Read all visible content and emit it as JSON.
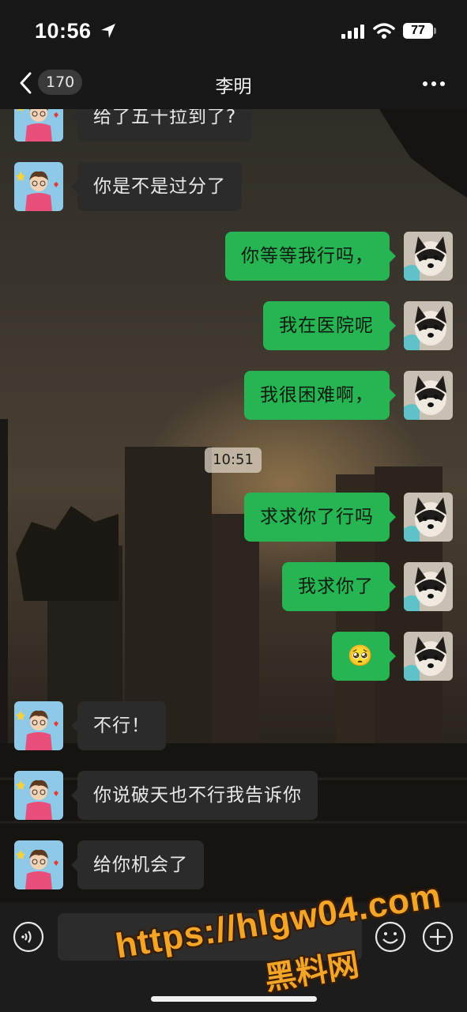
{
  "status_bar": {
    "time": "10:56",
    "battery": "77",
    "icons": [
      "location-arrow-icon",
      "signal-icon",
      "wifi-icon",
      "battery-icon"
    ]
  },
  "nav": {
    "back_icon": "chevron-left-icon",
    "unread_count": "170",
    "title": "李明",
    "more_icon": "more-dots-icon"
  },
  "messages": [
    {
      "side": "in",
      "text": "给了五十拉到了?"
    },
    {
      "side": "in",
      "text": "你是不是过分了"
    },
    {
      "side": "out",
      "text": "你等等我行吗，"
    },
    {
      "side": "out",
      "text": "我在医院呢"
    },
    {
      "side": "out",
      "text": "我很困难啊，"
    },
    {
      "side": "out",
      "text": "求求你了行吗"
    },
    {
      "side": "out",
      "text": "我求你了"
    },
    {
      "side": "out",
      "text": "🥺"
    },
    {
      "side": "in",
      "text": "不行！"
    },
    {
      "side": "in",
      "text": "你说破天也不行我告诉你"
    },
    {
      "side": "in",
      "text": "给你机会了"
    }
  ],
  "timestamp": "10:51",
  "input_bar": {
    "value": "",
    "icons": [
      "voice-icon",
      "emoji-icon",
      "plus-icon"
    ]
  },
  "watermark": {
    "url": "https://hlgw04.com",
    "name": "黑料网"
  },
  "colors": {
    "outgoing_bubble": "#26b552",
    "incoming_bubble": "#2b2b2b",
    "bar_background": "#171717"
  }
}
